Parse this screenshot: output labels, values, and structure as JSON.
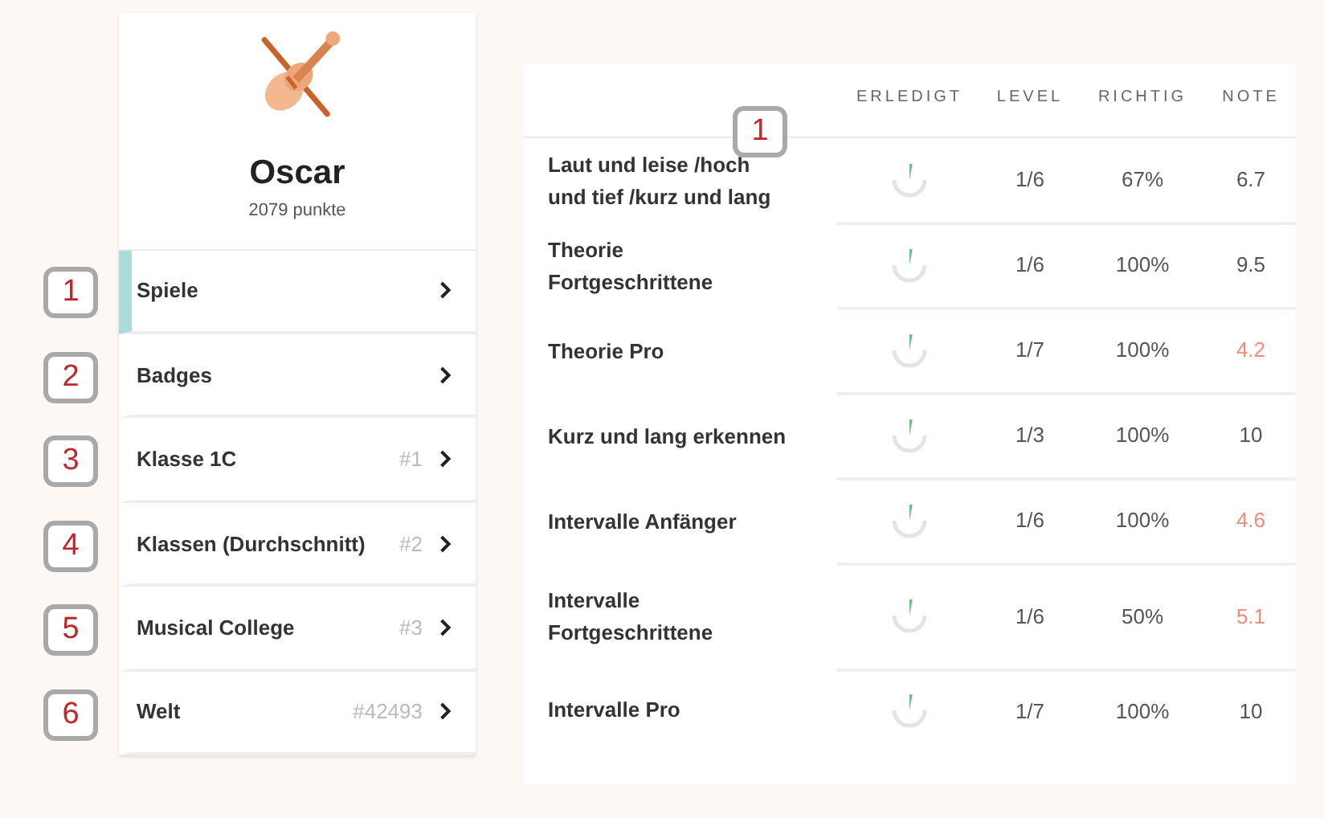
{
  "profile": {
    "name": "Oscar",
    "points": "2079 punkte"
  },
  "menu": [
    {
      "label": "Spiele",
      "selected": true,
      "callout": "1"
    },
    {
      "label": "Badges",
      "selected": false,
      "callout": "2"
    },
    {
      "label": "Klasse 1C",
      "rank": "#1",
      "selected": false,
      "callout": "3"
    },
    {
      "label": "Klassen (Durchschnitt)",
      "rank": "#2",
      "selected": false,
      "callout": "4"
    },
    {
      "label": "Musical College",
      "rank": "#3",
      "selected": false,
      "callout": "5"
    },
    {
      "label": "Welt",
      "rank": "#42493",
      "selected": false,
      "callout": "6"
    }
  ],
  "table": {
    "callout": "1",
    "columns": [
      "ERLEDIGT",
      "LEVEL",
      "RICHTIG",
      "NOTE"
    ],
    "rows": [
      {
        "name": "Laut und leise /hoch und tief /kurz und lang",
        "level_text": "1/6",
        "richtig": "67%",
        "note": "6.7",
        "warning": false
      },
      {
        "name": "Theorie Fortgeschrittene",
        "level_text": "1/6",
        "richtig": "100%",
        "note": "9.5",
        "warning": false
      },
      {
        "name": "Theorie Pro",
        "level_text": "1/7",
        "richtig": "100%",
        "note": "4.2",
        "warning": true
      },
      {
        "name": "Kurz und lang erkennen",
        "level_text": "1/3",
        "richtig": "100%",
        "note": "10",
        "warning": false
      },
      {
        "name": "Intervalle Anfänger",
        "level_text": "1/6",
        "richtig": "100%",
        "note": "4.6",
        "warning": true
      },
      {
        "name": "Intervalle Fortgeschrittene",
        "level_text": "1/6",
        "richtig": "50%",
        "note": "5.1",
        "warning": true
      },
      {
        "name": "Intervalle Pro",
        "level_text": "1/7",
        "richtig": "100%",
        "note": "10",
        "warning": false
      }
    ]
  }
}
